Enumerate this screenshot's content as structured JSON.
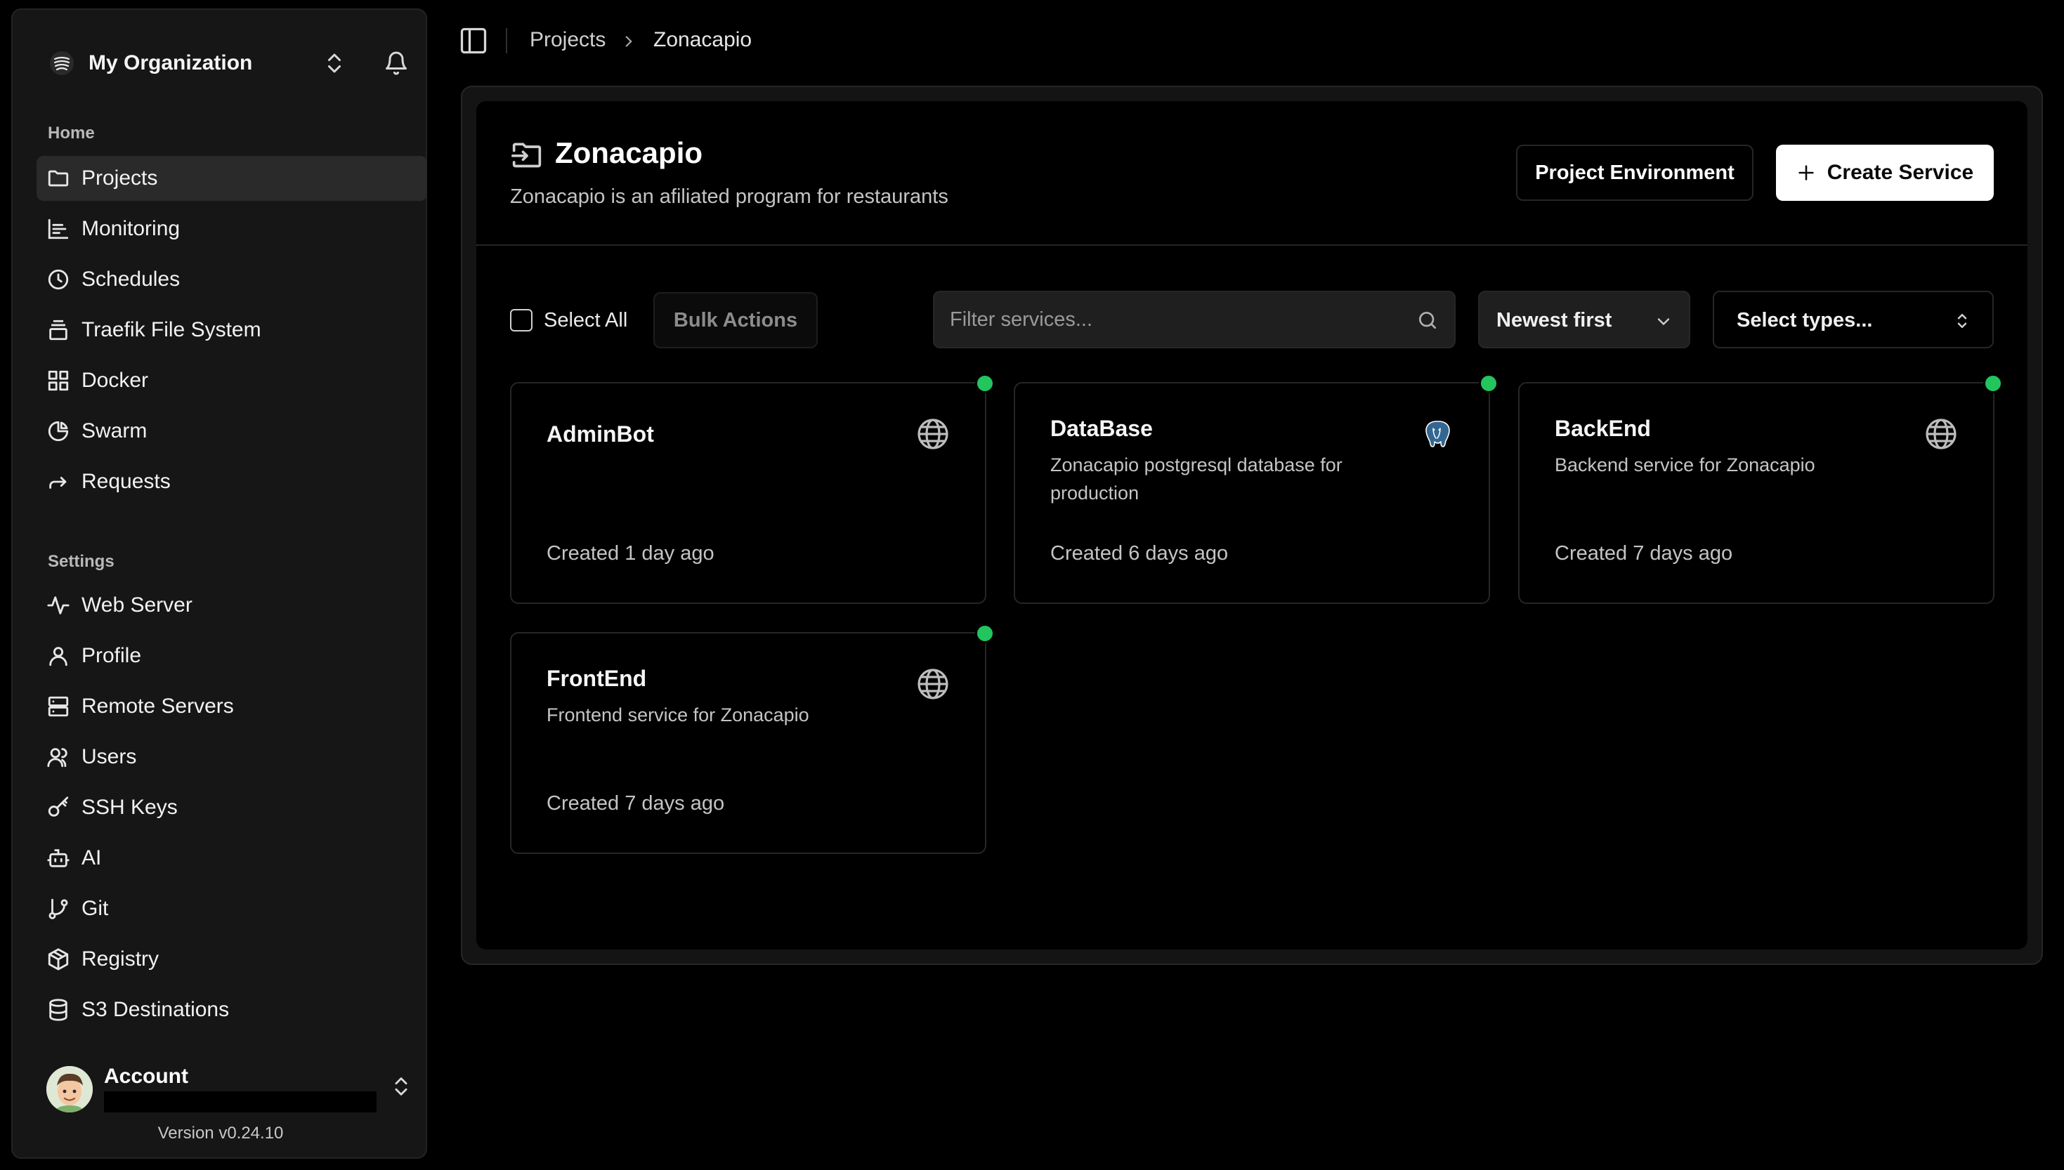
{
  "org": {
    "name": "My Organization"
  },
  "sidebar": {
    "home_title": "Home",
    "home_items": [
      {
        "label": "Projects",
        "icon": "folder-icon",
        "active": true
      },
      {
        "label": "Monitoring",
        "icon": "chart-icon"
      },
      {
        "label": "Schedules",
        "icon": "clock-icon"
      },
      {
        "label": "Traefik File System",
        "icon": "layers-icon"
      },
      {
        "label": "Docker",
        "icon": "blocks-icon"
      },
      {
        "label": "Swarm",
        "icon": "pie-icon"
      },
      {
        "label": "Requests",
        "icon": "forward-arrow-icon"
      }
    ],
    "settings_title": "Settings",
    "settings_items": [
      {
        "label": "Web Server",
        "icon": "activity-icon"
      },
      {
        "label": "Profile",
        "icon": "user-icon"
      },
      {
        "label": "Remote Servers",
        "icon": "server-icon"
      },
      {
        "label": "Users",
        "icon": "users-icon"
      },
      {
        "label": "SSH Keys",
        "icon": "key-icon"
      },
      {
        "label": "AI",
        "icon": "bot-icon"
      },
      {
        "label": "Git",
        "icon": "git-branch-icon"
      },
      {
        "label": "Registry",
        "icon": "package-icon"
      },
      {
        "label": "S3 Destinations",
        "icon": "database-icon"
      }
    ]
  },
  "account": {
    "label": "Account",
    "email": ""
  },
  "version": "Version v0.24.10",
  "breadcrumb": {
    "root": "Projects",
    "current": "Zonacapio"
  },
  "project": {
    "title": "Zonacapio",
    "description": "Zonacapio is an afiliated program for restaurants",
    "env_button": "Project Environment",
    "create_button": "Create Service"
  },
  "toolbar": {
    "select_all": "Select All",
    "bulk_actions": "Bulk Actions",
    "filter_placeholder": "Filter services...",
    "sort_value": "Newest first",
    "types_value": "Select types..."
  },
  "services": [
    {
      "name": "AdminBot",
      "description": "",
      "created": "Created 1 day ago",
      "icon": "globe-icon",
      "status_color": "#22c55e"
    },
    {
      "name": "DataBase",
      "description": "Zonacapio postgresql database for production",
      "created": "Created 6 days ago",
      "icon": "postgres-icon",
      "status_color": "#22c55e"
    },
    {
      "name": "BackEnd",
      "description": "Backend service for Zonacapio",
      "created": "Created 7 days ago",
      "icon": "globe-icon",
      "status_color": "#22c55e"
    },
    {
      "name": "FrontEnd",
      "description": "Frontend service for Zonacapio",
      "created": "Created 7 days ago",
      "icon": "globe-icon",
      "status_color": "#22c55e"
    }
  ]
}
